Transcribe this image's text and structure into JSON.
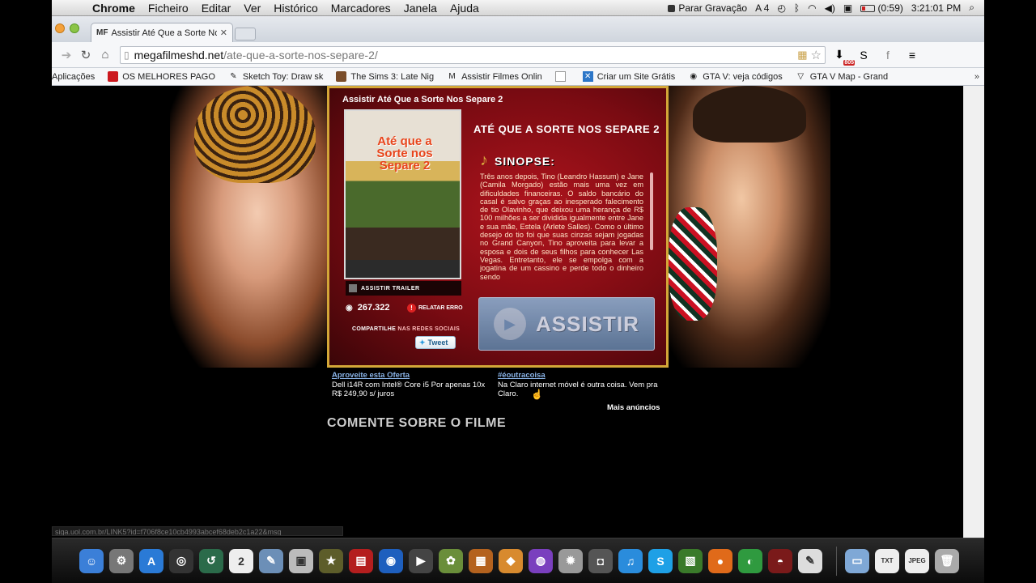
{
  "menubar": {
    "app_name": "Chrome",
    "menus": [
      "Ficheiro",
      "Editar",
      "Ver",
      "Histórico",
      "Marcadores",
      "Janela",
      "Ajuda"
    ],
    "recording": "Parar Gravação",
    "notif_count": "4",
    "battery_time": "(0:59)",
    "clock": "3:21:01 PM"
  },
  "tab": {
    "favicon": "MF",
    "title": "Assistir Até Que a Sorte Nos Separe 2"
  },
  "address": {
    "domain": "megafilmeshd.net",
    "path": "/ate-que-a-sorte-nos-separe-2/"
  },
  "extensions": {
    "badge": "805"
  },
  "bookmarks": [
    {
      "icon": "apps-icon",
      "label": "Aplicações"
    },
    {
      "icon": "youtube-icon",
      "label": "OS MELHORES PAGO"
    },
    {
      "icon": "sketch-icon",
      "label": "Sketch Toy: Draw sk"
    },
    {
      "icon": "sims-icon",
      "label": "The Sims 3: Late Nig"
    },
    {
      "icon": "mf-icon",
      "label": "Assistir Filmes Onlin"
    },
    {
      "icon": "page-icon",
      "label": ""
    },
    {
      "icon": "wix-icon",
      "label": "Criar um Site Grátis"
    },
    {
      "icon": "chrome-icon",
      "label": "GTA V: veja códigos"
    },
    {
      "icon": "gta-icon",
      "label": "GTA V Map - Grand"
    }
  ],
  "bookmarks_more": "»",
  "movie": {
    "panel_title": "Assistir Até Que a Sorte Nos Separe 2",
    "poster_title": "Até que a Sorte nos Separe 2",
    "film_title": "ATÉ QUE A SORTE NOS SEPARE 2",
    "synopsis_label": "SINOPSE:",
    "synopsis": "Três anos depois, Tino (Leandro Hassum) e Jane (Camila Morgado) estão mais uma vez em dificuldades financeiras. O saldo bancário do casal é salvo graças ao inesperado falecimento de tio Olavinho, que deixou uma herança de R$ 100 milhões a ser dividida igualmente entre Jane e sua mãe, Estela (Arlete Salles). Como o último desejo do tio foi que suas cinzas sejam jogadas no Grand Canyon, Tino aproveita para levar a esposa e dois de seus filhos para conhecer Las Vegas. Entretanto, ele se empolga com a jogatina de um cassino e perde todo o dinheiro sendo",
    "trailer_label": "ASSISTIR TRAILER",
    "views": "267.322",
    "report_label": "RELATAR ERRO",
    "share_label": "COMPARTILHE",
    "share_sub": "NAS REDES SOCIAIS",
    "tweet_label": "Tweet",
    "watch_label": "ASSISTIR"
  },
  "ads": [
    {
      "heading": "Aproveite esta Oferta",
      "text": "Dell i14R com Intel® Core i5 Por apenas 10x R$ 249,90 s/ juros"
    },
    {
      "heading": "#éoutracoisa",
      "text": "Na Claro internet móvel é outra coisa. Vem pra Claro."
    }
  ],
  "more_ads": "Mais anúncios",
  "comment_heading": "COMENTE SOBRE O FILME",
  "status_url": "siga.uol.com.br/LINK5?id=f706f8ce10cb4993abcef68deb2c1a22&msg",
  "dock_apps": [
    {
      "name": "finder-icon",
      "color": "#3b7fd8",
      "glyph": "☺"
    },
    {
      "name": "system-preferences-icon",
      "color": "#777",
      "glyph": "⚙"
    },
    {
      "name": "app-store-icon",
      "color": "#2a7ad6",
      "glyph": "A"
    },
    {
      "name": "dashboard-icon",
      "color": "#333",
      "glyph": "◎"
    },
    {
      "name": "time-machine-icon",
      "color": "#2b6b4a",
      "glyph": "↺"
    },
    {
      "name": "calendar-icon",
      "color": "#eee",
      "glyph": "2"
    },
    {
      "name": "preview-icon",
      "color": "#6c8fb7",
      "glyph": "✎"
    },
    {
      "name": "image-capture-icon",
      "color": "#bbb",
      "glyph": "▣"
    },
    {
      "name": "imovie-icon",
      "color": "#5d5d2a",
      "glyph": "★"
    },
    {
      "name": "photo-booth-icon",
      "color": "#b41e1e",
      "glyph": "▤"
    },
    {
      "name": "safari-icon",
      "color": "#1e5fbe",
      "glyph": "◉"
    },
    {
      "name": "dvd-player-icon",
      "color": "#444",
      "glyph": "▶"
    },
    {
      "name": "iphoto-icon",
      "color": "#6a8e3a",
      "glyph": "✿"
    },
    {
      "name": "photoshop-icon",
      "color": "#b4621e",
      "glyph": "▦"
    },
    {
      "name": "iwork-icon",
      "color": "#d88a2e",
      "glyph": "◆"
    },
    {
      "name": "itunes-connect-icon",
      "color": "#7a3fbe",
      "glyph": "◍"
    },
    {
      "name": "automator-icon",
      "color": "#999",
      "glyph": "✹"
    },
    {
      "name": "facetime-icon",
      "color": "#555",
      "glyph": "◘"
    },
    {
      "name": "itunes-icon",
      "color": "#2a8cdc",
      "glyph": "♫"
    },
    {
      "name": "skype-icon",
      "color": "#1ea0e6",
      "glyph": "S"
    },
    {
      "name": "photo-editor-icon",
      "color": "#3a7a2a",
      "glyph": "▧"
    },
    {
      "name": "firefox-icon",
      "color": "#e06a1a",
      "glyph": "●"
    },
    {
      "name": "chrome-dock-icon",
      "color": "#2f9a3f",
      "glyph": "◐"
    },
    {
      "name": "steam-icon",
      "color": "#7a1a1a",
      "glyph": "◓"
    },
    {
      "name": "textedit-icon",
      "color": "#ddd",
      "glyph": "✎"
    }
  ],
  "dock_right": [
    {
      "name": "applications-folder-icon",
      "color": "#7fa8d6",
      "glyph": "▭"
    },
    {
      "name": "txt-file-icon",
      "color": "#eee",
      "glyph": "TXT"
    },
    {
      "name": "jpeg-file-icon",
      "color": "#eee",
      "glyph": "JPEG"
    },
    {
      "name": "trash-icon",
      "color": "#aaa",
      "glyph": "🗑"
    }
  ]
}
